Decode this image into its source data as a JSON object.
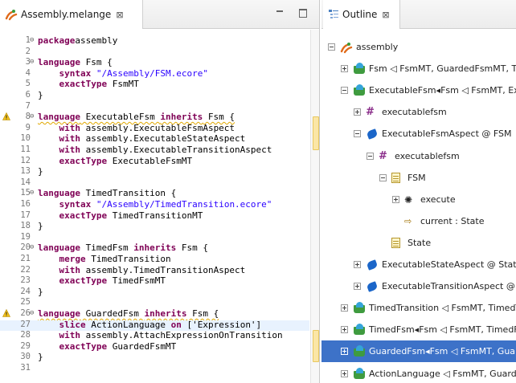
{
  "editor": {
    "tab_title": "Assembly.melange",
    "tab_close": "⊠",
    "lines": [
      {
        "n": "1",
        "fold": "⊖",
        "parts": [
          [
            "kw",
            "package"
          ],
          [
            "",
            "assembly"
          ]
        ]
      },
      {
        "n": "2",
        "parts": []
      },
      {
        "n": "3",
        "fold": "⊖",
        "parts": [
          [
            "kw",
            "language"
          ],
          [
            "",
            " Fsm {"
          ]
        ]
      },
      {
        "n": "4",
        "parts": [
          [
            "",
            "    "
          ],
          [
            "kw",
            "syntax"
          ],
          [
            "",
            " "
          ],
          [
            "str",
            "\"/Assembly/FSM.ecore\""
          ]
        ]
      },
      {
        "n": "5",
        "parts": [
          [
            "",
            "    "
          ],
          [
            "kw",
            "exactType"
          ],
          [
            "",
            " FsmMT"
          ]
        ]
      },
      {
        "n": "6",
        "parts": [
          [
            "",
            "}"
          ]
        ]
      },
      {
        "n": "7",
        "parts": []
      },
      {
        "n": "8",
        "fold": "⊖",
        "warn": true,
        "parts": [
          [
            "kw",
            "language"
          ],
          [
            "",
            " ExecutableFsm "
          ],
          [
            "kw",
            "inherits"
          ],
          [
            "",
            " Fsm {"
          ]
        ]
      },
      {
        "n": "9",
        "parts": [
          [
            "",
            "    "
          ],
          [
            "kw",
            "with"
          ],
          [
            "",
            " assembly.ExecutableFsmAspect"
          ]
        ]
      },
      {
        "n": "10",
        "parts": [
          [
            "",
            "    "
          ],
          [
            "kw",
            "with"
          ],
          [
            "",
            " assembly.ExecutableStateAspect"
          ]
        ]
      },
      {
        "n": "11",
        "parts": [
          [
            "",
            "    "
          ],
          [
            "kw",
            "with"
          ],
          [
            "",
            " assembly.ExecutableTransitionAspect"
          ]
        ]
      },
      {
        "n": "12",
        "parts": [
          [
            "",
            "    "
          ],
          [
            "kw",
            "exactType"
          ],
          [
            "",
            " ExecutableFsmMT"
          ]
        ]
      },
      {
        "n": "13",
        "parts": [
          [
            "",
            "}"
          ]
        ]
      },
      {
        "n": "14",
        "parts": []
      },
      {
        "n": "15",
        "fold": "⊖",
        "parts": [
          [
            "kw",
            "language"
          ],
          [
            "",
            " TimedTransition {"
          ]
        ]
      },
      {
        "n": "16",
        "parts": [
          [
            "",
            "    "
          ],
          [
            "kw",
            "syntax"
          ],
          [
            "",
            " "
          ],
          [
            "str",
            "\"/Assembly/TimedTransition.ecore\""
          ]
        ]
      },
      {
        "n": "17",
        "parts": [
          [
            "",
            "    "
          ],
          [
            "kw",
            "exactType"
          ],
          [
            "",
            " TimedTransitionMT"
          ]
        ]
      },
      {
        "n": "18",
        "parts": [
          [
            "",
            "}"
          ]
        ]
      },
      {
        "n": "19",
        "parts": []
      },
      {
        "n": "20",
        "fold": "⊖",
        "parts": [
          [
            "kw",
            "language"
          ],
          [
            "",
            " TimedFsm "
          ],
          [
            "kw",
            "inherits"
          ],
          [
            "",
            " Fsm {"
          ]
        ]
      },
      {
        "n": "21",
        "parts": [
          [
            "",
            "    "
          ],
          [
            "kw",
            "merge"
          ],
          [
            "",
            " TimedTransition"
          ]
        ]
      },
      {
        "n": "22",
        "parts": [
          [
            "",
            "    "
          ],
          [
            "kw",
            "with"
          ],
          [
            "",
            " assembly.TimedTransitionAspect"
          ]
        ]
      },
      {
        "n": "23",
        "parts": [
          [
            "",
            "    "
          ],
          [
            "kw",
            "exactType"
          ],
          [
            "",
            " TimedFsmMT"
          ]
        ]
      },
      {
        "n": "24",
        "parts": [
          [
            "",
            "}"
          ]
        ]
      },
      {
        "n": "25",
        "parts": []
      },
      {
        "n": "26",
        "fold": "⊖",
        "warn": true,
        "parts": [
          [
            "kw",
            "language"
          ],
          [
            "",
            " GuardedFsm "
          ],
          [
            "kw",
            "inherits"
          ],
          [
            "",
            " Fsm {"
          ]
        ]
      },
      {
        "n": "27",
        "highlight": true,
        "parts": [
          [
            "",
            "    "
          ],
          [
            "kw",
            "slice"
          ],
          [
            "",
            " ActionLanguage "
          ],
          [
            "kw",
            "on"
          ],
          [
            "",
            " ['Expression']"
          ]
        ]
      },
      {
        "n": "28",
        "parts": [
          [
            "",
            "    "
          ],
          [
            "kw",
            "with"
          ],
          [
            "",
            " assembly.AttachExpressionOnTransition"
          ]
        ]
      },
      {
        "n": "29",
        "parts": [
          [
            "",
            "    "
          ],
          [
            "kw",
            "exactType"
          ],
          [
            "",
            " GuardedFsmMT"
          ]
        ]
      },
      {
        "n": "30",
        "parts": [
          [
            "",
            "}"
          ]
        ]
      },
      {
        "n": "31",
        "parts": []
      }
    ]
  },
  "outline": {
    "tab_title": "Outline",
    "tab_close": "⊠",
    "nodes": [
      {
        "label": "assembly",
        "icon": "melange-project-icon",
        "expander": "minus",
        "depth": 0
      },
      {
        "label": "Fsm ◁ FsmMT, GuardedFsmMT, Tim",
        "icon": "language-icon",
        "expander": "plus",
        "depth": 1
      },
      {
        "label": "ExecutableFsm◂Fsm ◁ FsmMT, Exe",
        "icon": "language-icon",
        "expander": "minus",
        "depth": 1
      },
      {
        "label": "executablefsm",
        "icon": "package-icon",
        "expander": "plus",
        "depth": 2
      },
      {
        "label": "ExecutableFsmAspect @ FSM",
        "icon": "aspect-icon",
        "expander": "minus",
        "depth": 2
      },
      {
        "label": "executablefsm",
        "icon": "package-icon",
        "expander": "minus",
        "depth": 3
      },
      {
        "label": "FSM",
        "icon": "class-icon",
        "expander": "minus",
        "depth": 4
      },
      {
        "label": "execute",
        "icon": "operation-icon",
        "expander": "plus",
        "depth": 5
      },
      {
        "label": "current : State",
        "icon": "attribute-icon",
        "expander": "",
        "depth": 5
      },
      {
        "label": "State",
        "icon": "class-icon",
        "expander": "",
        "depth": 4
      },
      {
        "label": "ExecutableStateAspect @ State",
        "icon": "aspect-icon",
        "expander": "plus",
        "depth": 2
      },
      {
        "label": "ExecutableTransitionAspect @ Tr",
        "icon": "aspect-icon",
        "expander": "plus",
        "depth": 2
      },
      {
        "label": "TimedTransition ◁ FsmMT, TimedTr",
        "icon": "language-icon",
        "expander": "plus",
        "depth": 1
      },
      {
        "label": "TimedFsm◂Fsm ◁ FsmMT, TimedFsm",
        "icon": "language-icon",
        "expander": "plus",
        "depth": 1
      },
      {
        "label": "GuardedFsm◂Fsm ◁ FsmMT, Guarde",
        "icon": "language-icon",
        "expander": "plus",
        "depth": 1,
        "selected": true
      },
      {
        "label": "ActionLanguage ◁ FsmMT, Guarded",
        "icon": "language-icon",
        "expander": "plus",
        "depth": 1
      }
    ]
  },
  "colors": {
    "keyword": "#7f0055",
    "string": "#2a00ff",
    "selection": "#3d72c8",
    "line_highlight": "#e8f2fe"
  }
}
